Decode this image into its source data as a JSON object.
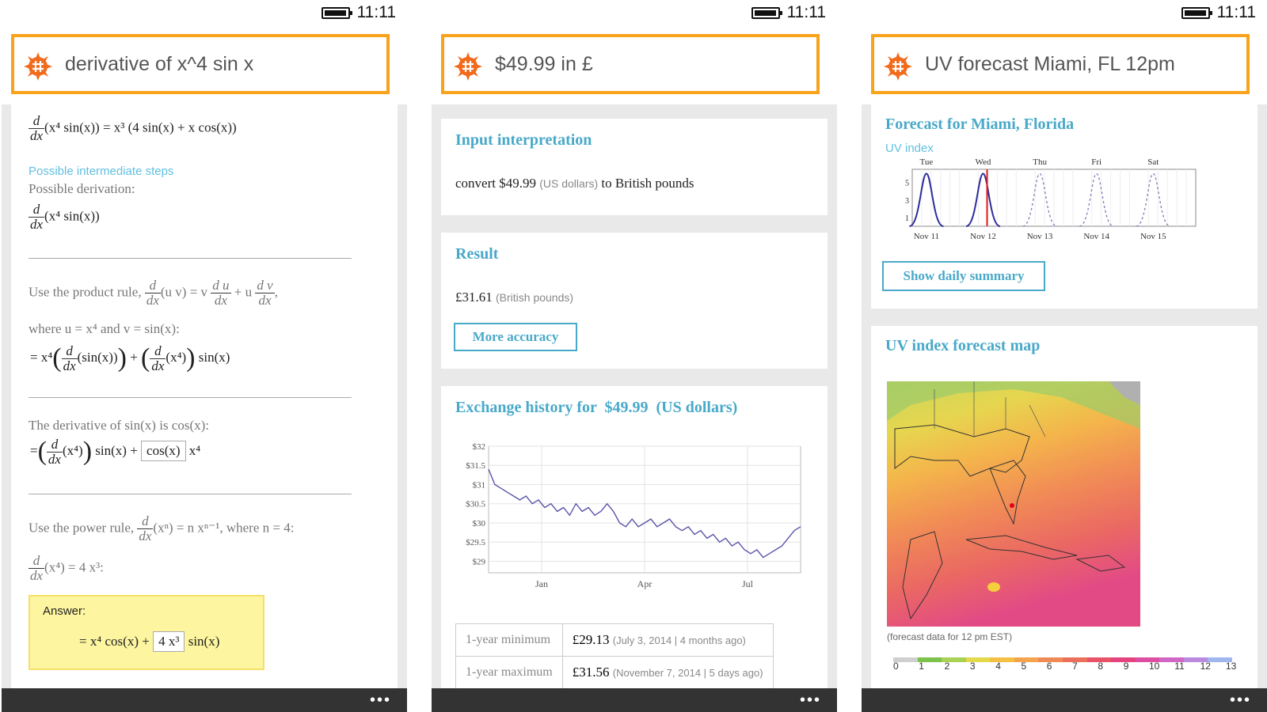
{
  "status": {
    "time": "11:11"
  },
  "panel1": {
    "query": "derivative of x^4 sin x",
    "result_lhs_op": "d",
    "result_lhs_den": "dx",
    "result_lhs_expr": "(x⁴ sin(x)) = x³ (4 sin(x) + x cos(x))",
    "steps_link": "Possible intermediate steps",
    "derivation_label": "Possible derivation:",
    "derivation_expr": "(x⁴ sin(x))",
    "step1_text": "Use the product rule,",
    "step1_formula": "(u v) = v",
    "step1_plus": "+ u",
    "step1_where": "where u = x⁴ and v = sin(x):",
    "step1_result_pre": "= x⁴",
    "step1_result_mid": "(sin(x))",
    "step1_result_plus": "+",
    "step1_result_post": "(x⁴)",
    "step1_result_end": "sin(x)",
    "step2_text": "The derivative of sin(x) is cos(x):",
    "step2_pre": "=",
    "step2_mid": "(x⁴)",
    "step2_sin": "sin(x) +",
    "step2_box": "cos(x)",
    "step2_end": "x⁴",
    "step3_text": "Use the power rule,",
    "step3_formula": "(xⁿ) = n xⁿ⁻¹, where n = 4:",
    "step3_result": "(x⁴) = 4 x³:",
    "answer_label": "Answer:",
    "answer_pre": "= x⁴ cos(x) +",
    "answer_box": "4 x³",
    "answer_post": "sin(x)",
    "frac_d": "d",
    "frac_dx": "dx",
    "frac_du": "d u",
    "frac_dv": "d v"
  },
  "panel2": {
    "query": "$49.99 in £",
    "input_title": "Input interpretation",
    "input_convert": "convert $49.99",
    "input_unit": "(US dollars)",
    "input_to": "to British pounds",
    "result_title": "Result",
    "result_value": "£31.61",
    "result_unit": "(British pounds)",
    "more_accuracy": "More accuracy",
    "history_title": "Exchange history for  $49.99  (US dollars)",
    "table": [
      {
        "label": "1-year  minimum",
        "value": "£29.13",
        "note": "(July 3, 2014 | 4 months ago)"
      },
      {
        "label": "1-year  maximum",
        "value": "£31.56",
        "note": "(November 7, 2014 | 5 days ago)"
      }
    ]
  },
  "panel3": {
    "query": "UV forecast Miami, FL 12pm",
    "forecast_title": "Forecast for Miami, Florida",
    "uv_label": "UV index",
    "show_summary": "Show daily summary",
    "map_title": "UV index forecast map",
    "map_caption": "(forecast data for 12 pm EST)",
    "scale": [
      "0",
      "1",
      "2",
      "3",
      "4",
      "5",
      "6",
      "7",
      "8",
      "9",
      "10",
      "11",
      "12",
      "13"
    ],
    "scale_colors": [
      "#cfcfcf",
      "#7cc24b",
      "#a9d155",
      "#e3d94b",
      "#f4c043",
      "#f3a44d",
      "#f08a55",
      "#ec6f5c",
      "#e8536a",
      "#e4437f",
      "#dd4ea0",
      "#d266c4",
      "#b98ae0",
      "#9fb6ef"
    ]
  },
  "chart_data": [
    {
      "type": "line",
      "x_tick_labels": [
        "Jan",
        "Apr",
        "Jul"
      ],
      "y_tick_labels": [
        "$32",
        "$31.5",
        "$31",
        "$30.5",
        "$30",
        "$29.5",
        "$29"
      ],
      "ylim": [
        28.7,
        32
      ],
      "grid": true,
      "series": [
        {
          "values": [
            31.4,
            31.0,
            30.9,
            30.8,
            30.7,
            30.6,
            30.7,
            30.5,
            30.6,
            30.4,
            30.5,
            30.3,
            30.4,
            30.2,
            30.5,
            30.3,
            30.4,
            30.2,
            30.3,
            30.5,
            30.3,
            30.0,
            29.9,
            30.1,
            29.9,
            30.0,
            30.1,
            29.9,
            30.0,
            30.1,
            29.9,
            29.8,
            29.9,
            29.7,
            29.8,
            29.6,
            29.7,
            29.5,
            29.6,
            29.4,
            29.5,
            29.3,
            29.2,
            29.3,
            29.1,
            29.2,
            29.3,
            29.4,
            29.6,
            29.8,
            29.9
          ]
        }
      ]
    },
    {
      "type": "line",
      "title": "Forecast for Miami, Florida",
      "ylabel": "UV index",
      "day_labels": [
        "Tue",
        "Wed",
        "Thu",
        "Fri",
        "Sat"
      ],
      "date_labels": [
        "Nov 11",
        "Nov 12",
        "Nov 13",
        "Nov 14",
        "Nov 15"
      ],
      "y_tick_labels": [
        "5",
        "3",
        "1"
      ],
      "ylim": [
        0,
        6.5
      ],
      "series": [
        {
          "style": "solid",
          "peaks": [
            6,
            6
          ]
        },
        {
          "style": "dashed",
          "peaks": [
            6,
            6,
            6
          ]
        }
      ]
    }
  ]
}
